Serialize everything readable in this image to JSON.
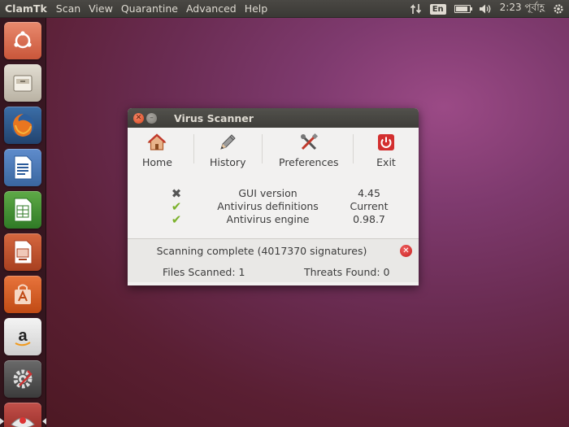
{
  "topbar": {
    "app_name": "ClamTk",
    "menu": [
      "Scan",
      "View",
      "Quarantine",
      "Advanced",
      "Help"
    ],
    "language": "En",
    "clock": "2:23 পূর্বাহ্ণ"
  },
  "launcher": {
    "items": [
      "ubuntu-dash",
      "files",
      "firefox",
      "writer",
      "calc",
      "impress",
      "software-center",
      "amazon",
      "system-settings",
      "clamtk"
    ]
  },
  "window": {
    "title": "Virus Scanner",
    "toolbar": {
      "home": "Home",
      "history": "History",
      "preferences": "Preferences",
      "exit": "Exit"
    },
    "status_rows": [
      {
        "label": "GUI version",
        "value": "4.45",
        "ok": false
      },
      {
        "label": "Antivirus definitions",
        "value": "Current",
        "ok": true
      },
      {
        "label": "Antivirus engine",
        "value": "0.98.7",
        "ok": true
      }
    ],
    "scan_message": "Scanning complete (4017370 signatures)",
    "files_scanned": "Files Scanned: 1",
    "threats_found": "Threats Found: 0"
  },
  "colors": {
    "accent_orange": "#dd4814",
    "check_green": "#7bb12b",
    "panel_bg": "#3c3b37"
  }
}
